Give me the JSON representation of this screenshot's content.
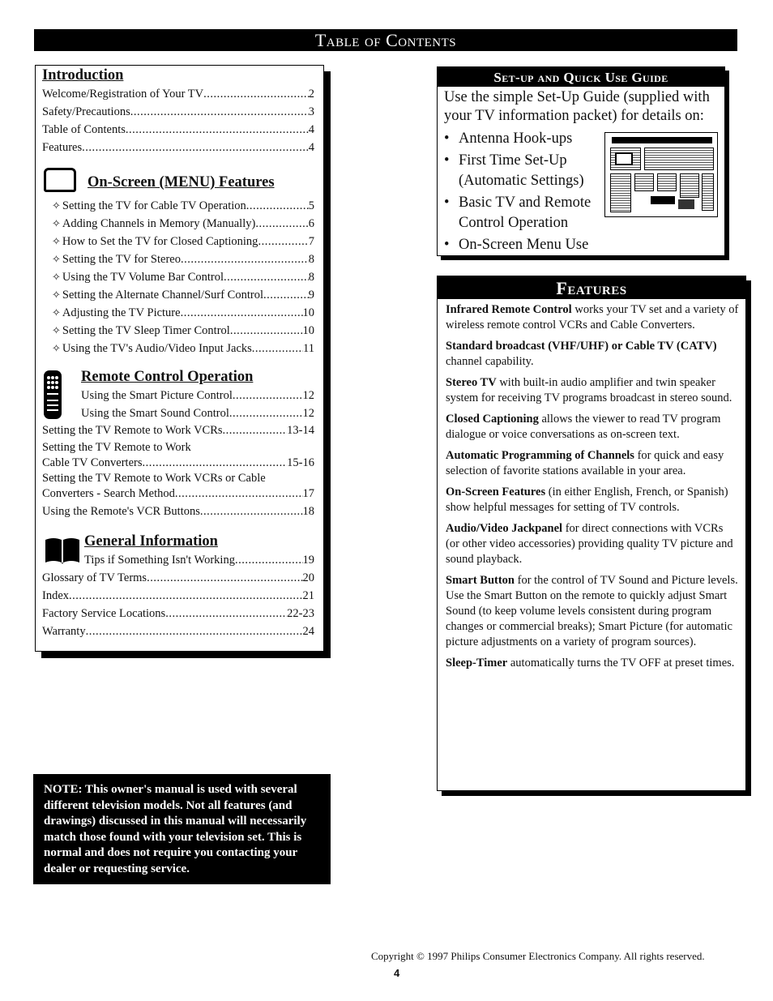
{
  "page_title": "Table of Contents",
  "toc": {
    "introduction": {
      "heading": "Introduction",
      "items": [
        {
          "title": "Welcome/Registration of Your TV",
          "page": "2"
        },
        {
          "title": "Safety/Precautions",
          "page": "3"
        },
        {
          "title": "Table of Contents",
          "page": "4"
        },
        {
          "title": "Features",
          "page": "4"
        }
      ]
    },
    "onscreen": {
      "heading": "On-Screen (MENU) Features",
      "items": [
        {
          "title": "Setting the TV for Cable TV Operation",
          "page": "5"
        },
        {
          "title": "Adding Channels in Memory (Manually)",
          "page": "6"
        },
        {
          "title": "How to Set the TV for Closed Captioning",
          "page": "7"
        },
        {
          "title": "Setting the TV for Stereo",
          "page": "8"
        },
        {
          "title": "Using the TV Volume Bar Control",
          "page": "8"
        },
        {
          "title": "Setting the Alternate Channel/Surf Control",
          "page": "9"
        },
        {
          "title": "Adjusting the TV Picture",
          "page": "10"
        },
        {
          "title": "Setting the TV Sleep Timer Control",
          "page": "10"
        },
        {
          "title": "Using the TV's Audio/Video Input Jacks",
          "page": "11"
        }
      ]
    },
    "remote": {
      "heading": "Remote Control Operation",
      "items": [
        {
          "title": "Using the Smart Picture Control",
          "page": "12"
        },
        {
          "title": "Using the Smart Sound Control",
          "page": "12"
        },
        {
          "title": "Setting the TV Remote to Work VCRs",
          "page": "13-14"
        },
        {
          "title_line1": "Setting the TV Remote to Work",
          "title": "Cable TV Converters",
          "page": "15-16"
        },
        {
          "title_line1": "Setting the TV Remote to Work VCRs or Cable",
          "title": "Converters - Search Method",
          "page": "17"
        },
        {
          "title": "Using the Remote's VCR Buttons",
          "page": "18"
        }
      ]
    },
    "general": {
      "heading": "General Information",
      "items": [
        {
          "title": "Tips if Something Isn't Working",
          "page": "19"
        },
        {
          "title": "Glossary of TV Terms",
          "page": "20"
        },
        {
          "title": "Index",
          "page": "21"
        },
        {
          "title": "Factory Service Locations",
          "page": "22-23"
        },
        {
          "title": "Warranty",
          "page": "24"
        }
      ]
    }
  },
  "note": "NOTE: This owner's manual is used with several different television models. Not all features (and drawings) discussed in this manual will necessarily match those found with your television set. This is normal and does not require you contacting your dealer or requesting service.",
  "setup_guide": {
    "heading": "Set-up and Quick Use Guide",
    "intro": "Use the simple Set-Up Guide (supplied with your TV information packet) for details on:",
    "bullets": [
      "Antenna Hook-ups",
      "First Time Set-Up (Automatic Settings)",
      "Basic TV and Remote Control Operation",
      "On-Screen Menu Use"
    ],
    "thumbnail_title": "Set-Up and Quick Use Guide"
  },
  "features": {
    "heading": "Features",
    "items": [
      {
        "bold": "Infrared Remote Control",
        "text": " works your TV set and a variety of wireless remote control VCRs and Cable Converters."
      },
      {
        "bold": "Standard broadcast (VHF/UHF) or Cable TV (CATV)",
        "text": " channel capability."
      },
      {
        "bold": "Stereo TV",
        "text": " with built-in audio amplifier and twin speaker system for receiving TV programs broadcast in stereo sound."
      },
      {
        "bold": "Closed Captioning",
        "text": " allows the viewer to read TV program dialogue or voice conversations as on-screen text."
      },
      {
        "bold": "Automatic Programming of Channels",
        "text": " for quick and easy selection of favorite stations available in your area."
      },
      {
        "bold": "On-Screen Features",
        "text": " (in either English, French, or Spanish) show helpful messages for setting of TV controls."
      },
      {
        "bold": "Audio/Video Jackpanel",
        "text": " for direct connections with VCRs (or other video accessories) providing quality TV picture and sound playback."
      },
      {
        "bold": "Smart Button",
        "text": " for the control of TV Sound and Picture levels. Use the Smart Button on the remote to quickly adjust Smart Sound (to keep volume levels consistent during program changes or commercial breaks); Smart Picture (for automatic picture adjustments on a variety of program sources)."
      },
      {
        "bold": "Sleep-Timer",
        "text": " automatically turns the TV OFF at preset times."
      }
    ]
  },
  "footer": {
    "copyright": "Copyright © 1997 Philips Consumer Electronics Company. All rights reserved.",
    "page_number": "4"
  }
}
